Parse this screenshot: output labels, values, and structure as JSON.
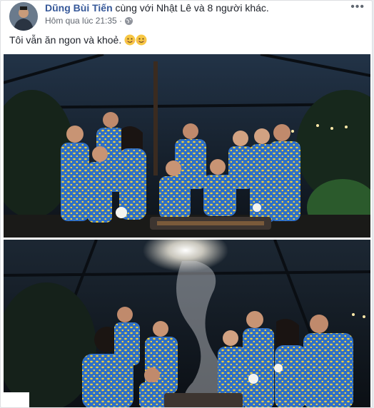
{
  "post": {
    "author_name": "Dũng Bùi Tiến",
    "with_text": " cùng với Nhật Lê và 8 người khác.",
    "timestamp": "Hôm qua lúc 21:35 ·",
    "privacy_icon": "globe-icon",
    "more_icon": "more-options-icon",
    "more_glyph": "•••",
    "message": "Tôi vẫn ăn ngon và khoẻ.",
    "emojis": [
      "smiling-face-icon",
      "smiling-face-icon"
    ]
  },
  "photos": [
    {
      "name": "photo-group-posing",
      "colors": {
        "sky": "#1d2a3a",
        "shirt": "#2e6fc7",
        "pattern": "#f2d23c"
      }
    },
    {
      "name": "photo-grill-smoke",
      "colors": {
        "sky": "#16202b",
        "shirt": "#2e6fc7",
        "pattern": "#f2d23c"
      }
    }
  ]
}
